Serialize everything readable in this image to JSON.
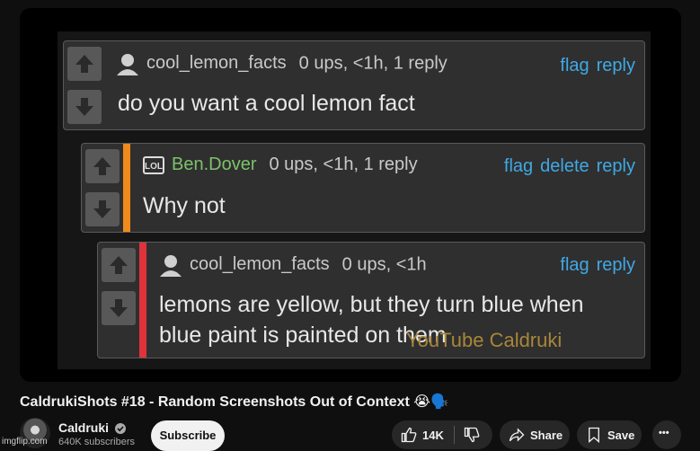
{
  "comments": [
    {
      "username": "cool_lemon_facts",
      "meta": "0 ups, <1h, 1 reply",
      "actions": [
        "flag",
        "reply"
      ],
      "text_lines": [
        "do you want a cool lemon fact"
      ]
    },
    {
      "badge": "LOL",
      "username": "Ben.Dover",
      "meta": "0 ups, <1h, 1 reply",
      "actions": [
        "flag",
        "delete",
        "reply"
      ],
      "text_lines": [
        "Why not"
      ],
      "accent_color": "#f08a1c"
    },
    {
      "username": "cool_lemon_facts",
      "meta": "0 ups, <1h",
      "actions": [
        "flag",
        "reply"
      ],
      "text_lines": [
        "lemons are yellow, but they turn blue when",
        "blue paint is painted on them"
      ],
      "accent_color": "#e0323a"
    }
  ],
  "watermark": "YouTube Caldruki",
  "video": {
    "title": "CaldrukiShots #18 - Random Screenshots Out of Context 😭🗣️"
  },
  "channel": {
    "name": "Caldruki",
    "subscribers": "640K subscribers"
  },
  "buttons": {
    "subscribe": "Subscribe",
    "likes": "14K",
    "share": "Share",
    "save": "Save",
    "more": "•••"
  },
  "footer_watermark": "imgflip.com",
  "colors": {
    "link_blue": "#3fa9e6",
    "username_green": "#7cc26a",
    "panel_bg": "#2f2f2f",
    "page_bg": "#0f0f0f"
  }
}
